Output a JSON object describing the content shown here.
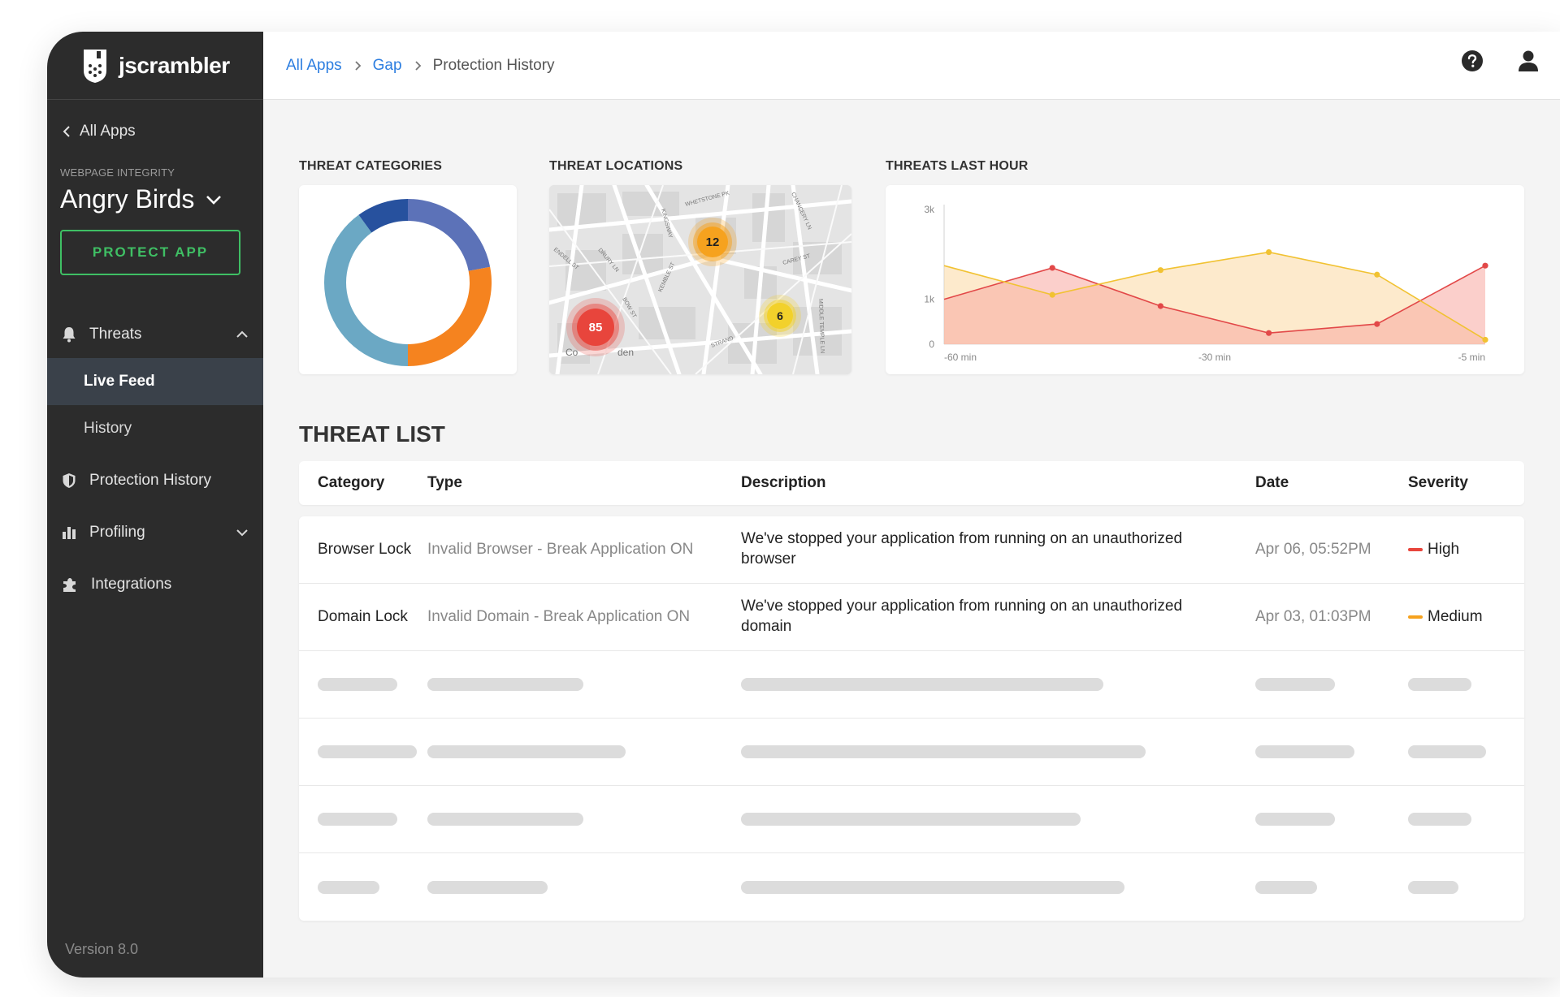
{
  "sidebar": {
    "logo_text": "jscrambler",
    "back_label": "All Apps",
    "app_kind": "WEBPAGE INTEGRITY",
    "app_name": "Angry Birds",
    "protect_label": "PROTECT APP",
    "nav": {
      "threats": "Threats",
      "live_feed": "Live Feed",
      "history": "History",
      "protection_history": "Protection History",
      "profiling": "Profiling",
      "integrations": "Integrations"
    },
    "version": "Version 8.0"
  },
  "breadcrumb": {
    "all_apps": "All Apps",
    "gap": "Gap",
    "current": "Protection History"
  },
  "sections": {
    "categories": "THREAT CATEGORIES",
    "locations": "THREAT LOCATIONS",
    "last_hour": "THREATS LAST HOUR",
    "list": "THREAT LIST"
  },
  "map": {
    "clusters": [
      {
        "count": "85",
        "level": "high"
      },
      {
        "count": "12",
        "level": "medium"
      },
      {
        "count": "6",
        "level": "low"
      }
    ],
    "street_labels": [
      "WHETSTONE PK",
      "KINGSWAY",
      "DRURY LN",
      "ENDELL ST",
      "CAREY ST",
      "KEMBLE ST",
      "BOW ST",
      "STRAND",
      "MIDDLE TEMPLE LN",
      "CHANCERY LN",
      "Co",
      "den"
    ]
  },
  "colors": {
    "accent_green": "#3fbf64",
    "link_blue": "#2d7ee0",
    "high": "#e8453c",
    "medium": "#f6a21e",
    "low": "#f2d12b",
    "donut_dark_blue": "#27519e",
    "donut_indigo": "#5c72b8",
    "donut_orange": "#f5831f",
    "donut_teal": "#6ba8c4",
    "line_red": "#e24848",
    "line_yellow": "#f1c232"
  },
  "chart_data": [
    {
      "type": "pie",
      "title": "THREAT CATEGORIES",
      "donut": true,
      "categories": [
        "",
        "",
        "",
        ""
      ],
      "values": [
        22,
        28,
        40,
        10
      ]
    },
    {
      "type": "area",
      "title": "THREATS LAST HOUR",
      "x": [
        "-60 min",
        "",
        "",
        "-30 min",
        "",
        "",
        "-5 min"
      ],
      "x_tick_labels": [
        "-60 min",
        "-30 min",
        "-5 min"
      ],
      "y_tick_labels": [
        "3k",
        "1k",
        "0"
      ],
      "y_ticks": [
        3000,
        1000,
        0
      ],
      "ylim": [
        0,
        3000
      ],
      "series": [
        {
          "values": [
            1000,
            1700,
            850,
            250,
            450,
            1750
          ],
          "x_index": [
            0,
            1,
            2,
            3,
            4,
            5
          ]
        },
        {
          "values": [
            1750,
            1100,
            1650,
            2050,
            1550,
            100
          ],
          "x_index": [
            0,
            1,
            2,
            3,
            4,
            5
          ]
        }
      ]
    }
  ],
  "table": {
    "headers": {
      "category": "Category",
      "type": "Type",
      "description": "Description",
      "date": "Date",
      "severity": "Severity"
    },
    "rows": [
      {
        "category": "Browser Lock",
        "type": "Invalid Browser - Break Application ON",
        "description": "We've stopped your application from running on an unauthorized browser",
        "date": "Apr 06, 05:52PM",
        "severity": "High",
        "severity_color": "#e8453c"
      },
      {
        "category": "Domain Lock",
        "type": "Invalid Domain - Break Application ON",
        "description": "We've stopped your application from running on an unauthorized domain",
        "date": "Apr 03, 01:03PM",
        "severity": "Medium",
        "severity_color": "#f6a21e"
      }
    ],
    "placeholder_rows": 4
  },
  "icons": {
    "help": "help-circle-icon",
    "user": "user-icon",
    "bell": "bell-icon",
    "shield": "shield-icon",
    "chart": "bar-chart-icon",
    "puzzle": "puzzle-icon"
  }
}
